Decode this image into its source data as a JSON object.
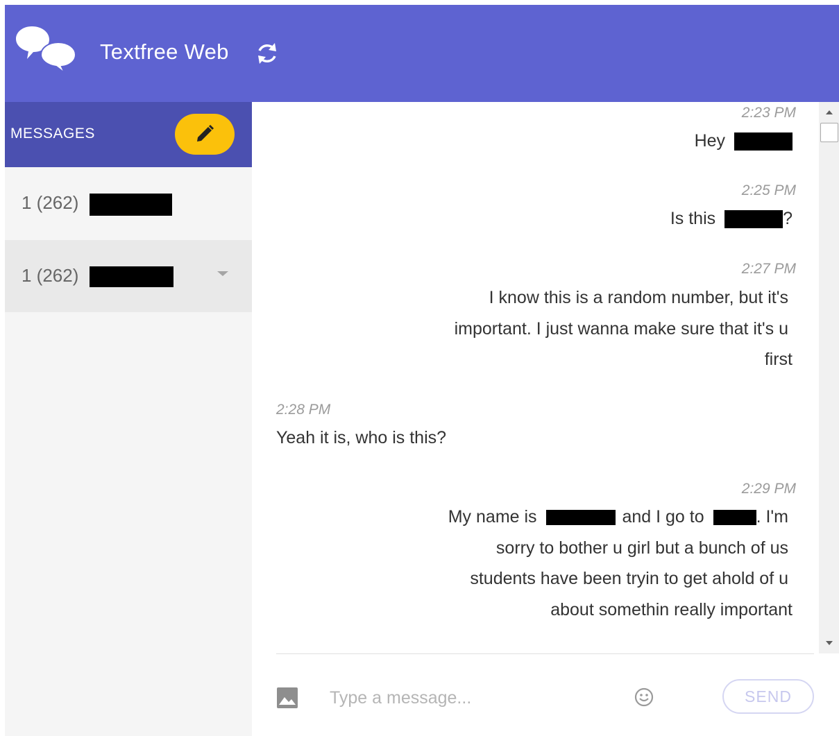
{
  "app": {
    "title": "Textfree Web"
  },
  "icons": {
    "logo": "chat-bubbles-icon",
    "refresh": "refresh-icon",
    "compose": "pencil-icon",
    "image": "image-icon",
    "emoji": "emoji-icon",
    "chevron": "chevron-down-icon"
  },
  "colors": {
    "header": "#5e63d1",
    "sidebar_header": "#4b50b0",
    "compose": "#fbc10b"
  },
  "sidebar": {
    "header_label": "MESSAGES",
    "conversations": [
      {
        "number": "1 (262)",
        "redacted": true
      },
      {
        "number": "1 (262)",
        "redacted": true,
        "selected": true
      }
    ]
  },
  "messages": [
    {
      "time": "2:23 PM",
      "direction": "outgoing",
      "text": "Hey"
    },
    {
      "time": "2:25 PM",
      "direction": "outgoing",
      "text_before": "Is this",
      "text_after": "?"
    },
    {
      "time": "2:27 PM",
      "direction": "outgoing",
      "lines": [
        "I know this is a random number, but it's",
        "important. I just wanna make sure that it's u",
        "first"
      ]
    },
    {
      "time": "2:28 PM",
      "direction": "incoming",
      "text": "Yeah it is, who is this?"
    },
    {
      "time": "2:29 PM",
      "direction": "outgoing",
      "line1_a": "My name is",
      "line1_b": "and I go to",
      "line1_c": ". I'm",
      "lines": [
        "sorry to bother u girl but a bunch of us",
        "students have been tryin to get ahold of u",
        "about somethin really important"
      ]
    }
  ],
  "composer": {
    "placeholder": "Type a message...",
    "send_label": "SEND"
  }
}
